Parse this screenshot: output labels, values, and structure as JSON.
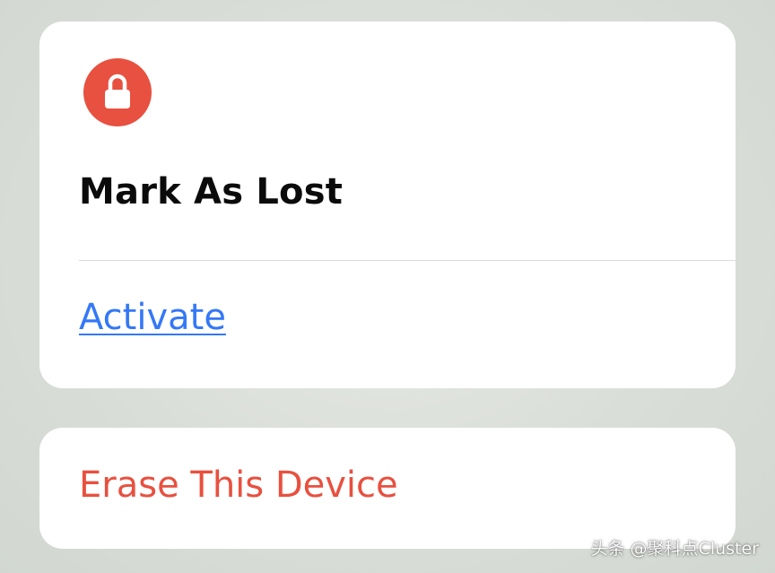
{
  "lost_card": {
    "icon": "lock-icon",
    "title": "Mark As Lost",
    "activate_label": "Activate"
  },
  "erase_card": {
    "label": "Erase This Device"
  },
  "watermark": "头条 @聚科点Cluster",
  "colors": {
    "lock_badge": "#e8503f",
    "link_blue": "#3478f6",
    "destructive_red": "#e8503f",
    "card_background": "#ffffff"
  }
}
